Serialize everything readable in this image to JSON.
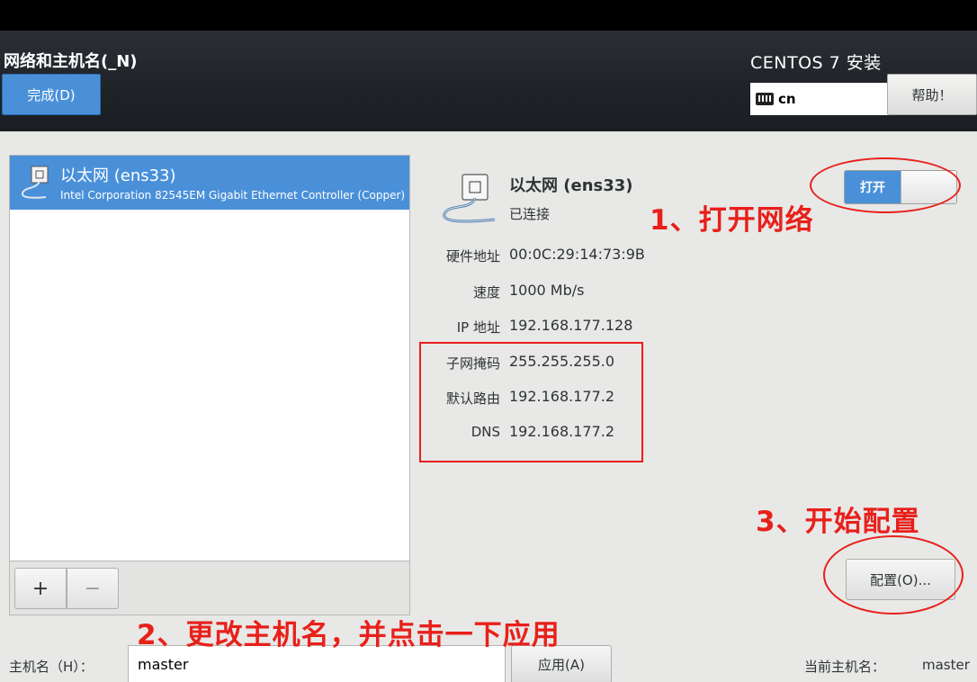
{
  "header": {
    "spoke_title": "网络和主机名(_N)",
    "done_label": "完成(D)",
    "product_title": "CENTOS 7 安装",
    "keyboard_layout": "cn",
    "help_label": "帮助！"
  },
  "device_list": {
    "items": [
      {
        "name": "以太网 (ens33)",
        "description": "Intel Corporation 82545EM Gigabit Ethernet Controller (Copper)",
        "icon": "ethernet-icon",
        "selected": true
      }
    ],
    "add_label": "+",
    "remove_label": "−"
  },
  "detail": {
    "name": "以太网 (ens33)",
    "status": "已连接",
    "icon": "ethernet-icon",
    "switch_label": "打开",
    "properties": [
      {
        "label": "硬件地址",
        "value": "00:0C:29:14:73:9B"
      },
      {
        "label": "速度",
        "value": "1000 Mb/s"
      },
      {
        "label": "IP 地址",
        "value": "192.168.177.128"
      },
      {
        "label": "子网掩码",
        "value": "255.255.255.0"
      },
      {
        "label": "默认路由",
        "value": "192.168.177.2"
      },
      {
        "label": "DNS",
        "value": "192.168.177.2"
      }
    ],
    "configure_label": "配置(O)..."
  },
  "hostname": {
    "label": "主机名（H）：",
    "value": "master",
    "apply_label": "应用(A)",
    "current_label": "当前主机名：",
    "current_value": "master"
  },
  "annotations": {
    "step1": "1、打开网络",
    "step2": "2、更改主机名，并点击一下应用",
    "step3": "3、开始配置",
    "color": "#e8201a"
  },
  "colors": {
    "accent": "#4a90d9",
    "header_bg": "#23272c"
  }
}
